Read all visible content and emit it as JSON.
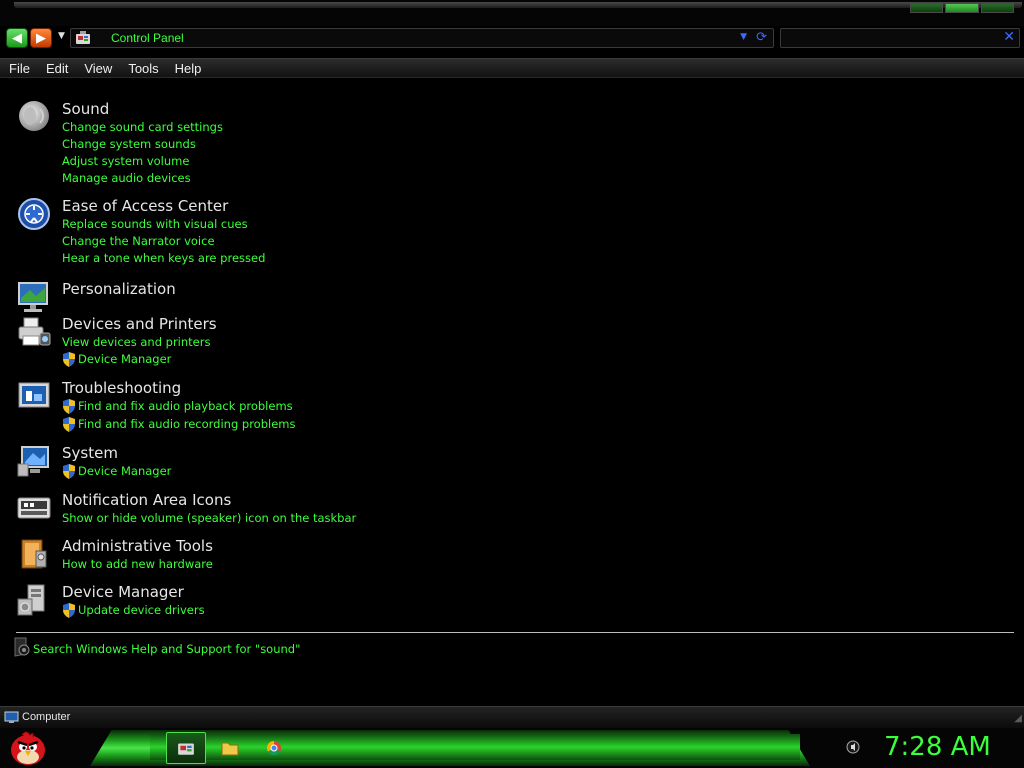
{
  "address_bar": {
    "path": "Control Panel",
    "search_placeholder": ""
  },
  "menu": [
    "File",
    "Edit",
    "View",
    "Tools",
    "Help"
  ],
  "groups": [
    {
      "title": "Sound",
      "icon": "speaker-icon",
      "links": [
        {
          "text": "Change sound card settings",
          "shield": false
        },
        {
          "text": "Change system sounds",
          "shield": false
        },
        {
          "text": "Adjust system volume",
          "shield": false
        },
        {
          "text": "Manage audio devices",
          "shield": false
        }
      ]
    },
    {
      "title": "Ease of Access Center",
      "icon": "ease-of-access-icon",
      "links": [
        {
          "text": "Replace sounds with visual cues",
          "shield": false
        },
        {
          "text": "Change the Narrator voice",
          "shield": false
        },
        {
          "text": "Hear a tone when keys are pressed",
          "shield": false
        }
      ]
    },
    {
      "title": "Personalization",
      "icon": "personalization-icon",
      "links": []
    },
    {
      "title": "Devices and Printers",
      "icon": "devices-printers-icon",
      "links": [
        {
          "text": "View devices and printers",
          "shield": false
        },
        {
          "text": "Device Manager",
          "shield": true
        }
      ]
    },
    {
      "title": "Troubleshooting",
      "icon": "troubleshooting-icon",
      "links": [
        {
          "text": "Find and fix audio playback problems",
          "shield": true
        },
        {
          "text": "Find and fix audio recording problems",
          "shield": true
        }
      ]
    },
    {
      "title": "System",
      "icon": "system-icon",
      "links": [
        {
          "text": "Device Manager",
          "shield": true
        }
      ]
    },
    {
      "title": "Notification Area Icons",
      "icon": "notification-area-icon",
      "links": [
        {
          "text": "Show or hide volume (speaker) icon on the taskbar",
          "shield": false
        }
      ]
    },
    {
      "title": "Administrative Tools",
      "icon": "administrative-tools-icon",
      "links": [
        {
          "text": "How to add new hardware",
          "shield": false
        }
      ]
    },
    {
      "title": "Device Manager",
      "icon": "device-manager-icon",
      "links": [
        {
          "text": "Update device drivers",
          "shield": true
        }
      ]
    }
  ],
  "help_link": "Search Windows Help and Support for \"sound\"",
  "status_bar": {
    "text": "Computer"
  },
  "taskbar": {
    "clock": "7:28 AM",
    "buttons": [
      "control-panel-icon",
      "folder-icon",
      "chrome-icon"
    ]
  },
  "colors": {
    "link": "#3cff3c",
    "accent": "#1ea81e",
    "background": "#000000"
  }
}
